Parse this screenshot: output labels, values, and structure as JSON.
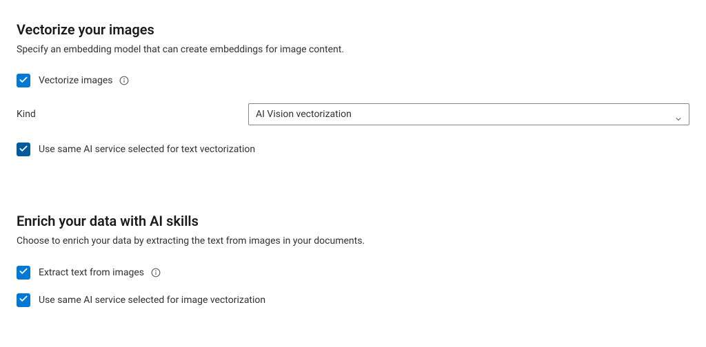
{
  "vectorize": {
    "title": "Vectorize your images",
    "subtitle": "Specify an embedding model that can create embeddings for image content.",
    "checkbox_vectorize_label": "Vectorize images",
    "kind_label": "Kind",
    "kind_value": "AI Vision vectorization",
    "checkbox_same_service_label": "Use same AI service selected for text vectorization"
  },
  "enrich": {
    "title": "Enrich your data with AI skills",
    "subtitle": "Choose to enrich your data by extracting the text from images in your documents.",
    "checkbox_extract_label": "Extract text from images",
    "checkbox_same_service_label": "Use same AI service selected for image vectorization"
  },
  "colors": {
    "brand_blue": "#0078d4",
    "brand_blue_dark": "#005a9e"
  },
  "icons": {
    "checkmark": "checkmark-icon",
    "info": "info-icon",
    "chevron_down": "chevron-down-icon"
  }
}
